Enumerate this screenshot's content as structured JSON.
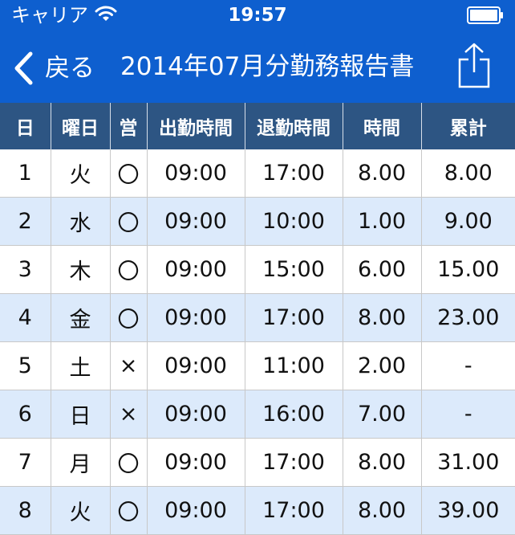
{
  "status_bar": {
    "carrier": "キャリア",
    "time": "19:57",
    "wifi_icon": "wifi-icon",
    "battery_icon": "battery-icon"
  },
  "nav": {
    "back_label": "戻る",
    "title": "2014年07月分勤務報告書",
    "back_icon": "chevron-left-icon",
    "share_icon": "share-icon"
  },
  "colors": {
    "nav_background": "#0e5fcf",
    "header_background": "#2d5583",
    "alt_row": "#dceafb"
  },
  "table": {
    "columns": [
      "日",
      "曜日",
      "営",
      "出勤時間",
      "退勤時間",
      "時間",
      "累計"
    ],
    "rows": [
      [
        "1",
        "火",
        "〇",
        "09:00",
        "17:00",
        "8.00",
        "8.00"
      ],
      [
        "2",
        "水",
        "〇",
        "09:00",
        "10:00",
        "1.00",
        "9.00"
      ],
      [
        "3",
        "木",
        "〇",
        "09:00",
        "15:00",
        "6.00",
        "15.00"
      ],
      [
        "4",
        "金",
        "〇",
        "09:00",
        "17:00",
        "8.00",
        "23.00"
      ],
      [
        "5",
        "土",
        "×",
        "09:00",
        "11:00",
        "2.00",
        "-"
      ],
      [
        "6",
        "日",
        "×",
        "09:00",
        "16:00",
        "7.00",
        "-"
      ],
      [
        "7",
        "月",
        "〇",
        "09:00",
        "17:00",
        "8.00",
        "31.00"
      ],
      [
        "8",
        "火",
        "〇",
        "09:00",
        "17:00",
        "8.00",
        "39.00"
      ]
    ]
  }
}
